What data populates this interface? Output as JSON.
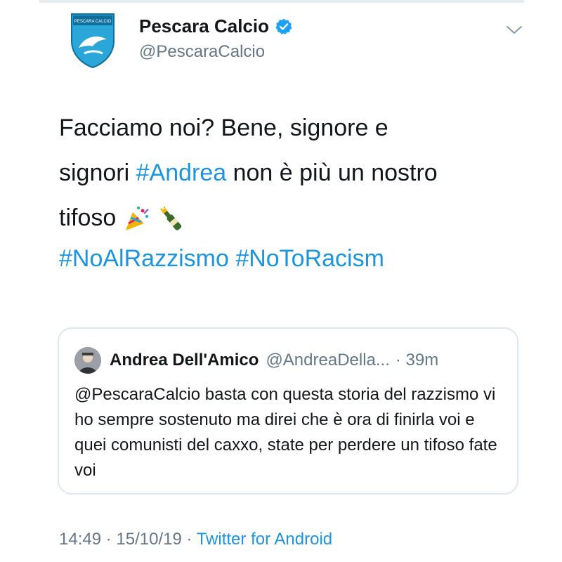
{
  "account": {
    "display_name": "Pescara Calcio",
    "handle": "@PescaraCalcio",
    "verified_icon": "verified-badge-icon",
    "logo_text": "PESCARA CALCIO"
  },
  "tweet": {
    "line1": "Facciamo noi? Bene, signore e",
    "line2_start": "signori ",
    "line2_hashtag": "#Andrea",
    "line2_end": " non è più un nostro",
    "line3": "tifoso ",
    "emoji1": "party-popper-icon",
    "emoji2": "champagne-bottle-icon",
    "hashtag1": "#NoAlRazzismo",
    "hashtag2": "#NoToRacism"
  },
  "quote": {
    "name": "Andrea Dell'Amico",
    "handle": "@AndreaDella...",
    "time": "· 39m",
    "text": "@PescaraCalcio basta con questa storia del razzismo vi ho sempre sostenuto ma direi che è ora di finirla voi e quei comunisti del caxxo, state per perdere un tifoso fate voi"
  },
  "footer": {
    "time": "14:49",
    "date": "15/10/19",
    "separator": " · ",
    "source": "Twitter for Android"
  },
  "colors": {
    "link": "#1b95e0",
    "secondary_text": "#657786",
    "border": "#e1e8ed"
  }
}
